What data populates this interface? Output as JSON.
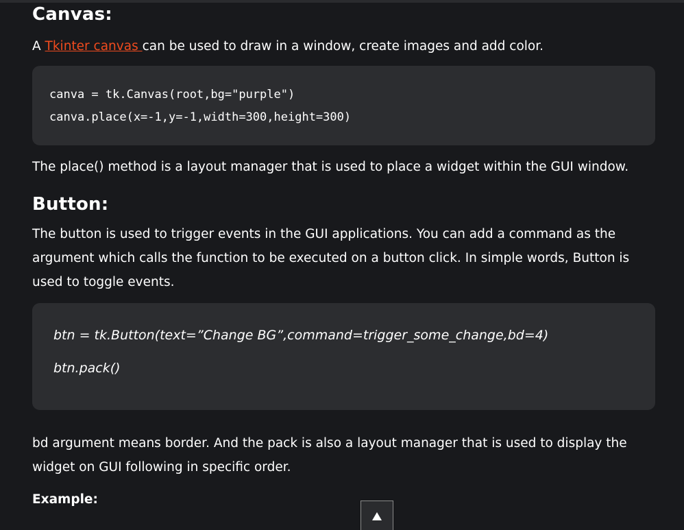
{
  "canvas_section": {
    "heading": "Canvas:",
    "intro_prefix": "A ",
    "intro_link": "Tkinter canvas ",
    "intro_suffix": "can be used to draw in a window, create images and add color.",
    "code_lines": [
      "canva = tk.Canvas(root,bg=\"purple\")",
      "canva.place(x=-1,y=-1,width=300,height=300)"
    ],
    "note": "The place() method is a layout manager that is used to place a widget within the GUI window."
  },
  "button_section": {
    "heading": "Button:",
    "description": "The button is used to trigger events in the GUI applications. You can add a command as the argument which calls the function to be executed on a button click. In simple words, Button is used to toggle events.",
    "code_lines": [
      "btn = tk.Button(text=”Change BG”,command=trigger_some_change,bd=4)",
      "btn.pack()"
    ],
    "note": "bd argument means border. And the pack is also a layout manager that is used to display the widget on GUI following in specific order.",
    "example_label": "Example:"
  },
  "scroll_top": {
    "icon": "arrow-up-icon"
  },
  "colors": {
    "background": "#18191c",
    "code_background": "#2c2d30",
    "link": "#ef4b1e"
  }
}
